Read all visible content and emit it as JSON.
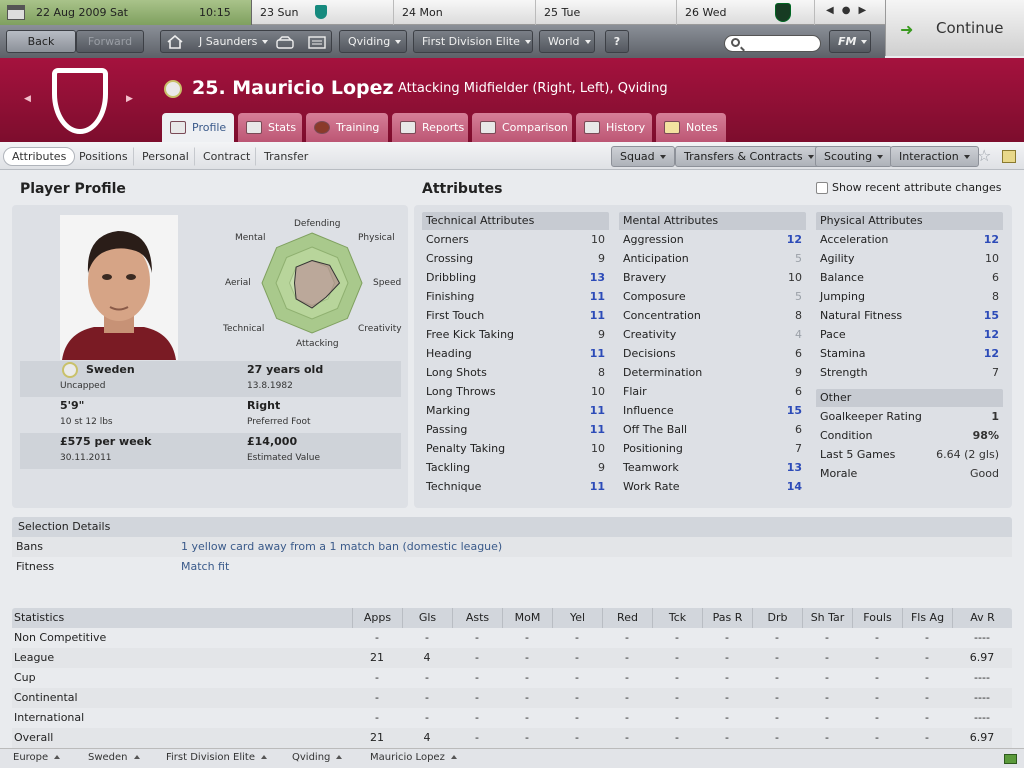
{
  "datebar": {
    "current_date": "22 Aug 2009  Sat",
    "current_time": "10:15",
    "days": [
      {
        "label": "23  Sun"
      },
      {
        "label": "24  Mon"
      },
      {
        "label": "25  Tue"
      },
      {
        "label": "26  Wed"
      }
    ]
  },
  "continue_label": "Continue",
  "toolbar": {
    "back": "Back",
    "forward": "Forward",
    "manager": "J Saunders",
    "club": "Qviding",
    "league": "First Division Elite",
    "world": "World",
    "help": "?",
    "fm": "FM"
  },
  "player": {
    "number_name": "25. Mauricio Lopez",
    "position": "Attacking Midfielder (Right, Left), Qviding"
  },
  "player_tabs": [
    {
      "label": "Profile"
    },
    {
      "label": "Stats"
    },
    {
      "label": "Training"
    },
    {
      "label": "Reports"
    },
    {
      "label": "Comparison"
    },
    {
      "label": "History"
    },
    {
      "label": "Notes"
    }
  ],
  "subtabs": [
    {
      "label": "Attributes"
    },
    {
      "label": "Positions"
    },
    {
      "label": "Personal"
    },
    {
      "label": "Contract"
    },
    {
      "label": "Transfer"
    }
  ],
  "menus": [
    {
      "label": "Squad"
    },
    {
      "label": "Transfers & Contracts"
    },
    {
      "label": "Scouting"
    },
    {
      "label": "Interaction"
    }
  ],
  "profile": {
    "title": "Player Profile",
    "nationality": "Sweden",
    "caps": "Uncapped",
    "age": "27 years old",
    "dob": "13.8.1982",
    "height": "5'9\"",
    "weight": "10 st 12 lbs",
    "foot": "Right",
    "foot_label": "Preferred Foot",
    "wage": "£575 per week",
    "contract_end": "30.11.2011",
    "value": "£14,000",
    "value_label": "Estimated Value",
    "radar_labels": {
      "defending": "Defending",
      "physical": "Physical",
      "speed": "Speed",
      "creativity": "Creativity",
      "attacking": "Attacking",
      "technical": "Technical",
      "aerial": "Aerial",
      "mental": "Mental"
    },
    "radar_values": {
      "Defending": 0.45,
      "Physical": 0.5,
      "Speed": 0.55,
      "Creativity": 0.4,
      "Attacking": 0.5,
      "Technical": 0.45,
      "Aerial": 0.35,
      "Mental": 0.45
    }
  },
  "attributes": {
    "title": "Attributes",
    "recent_label": "Show recent attribute changes",
    "technical": {
      "title": "Technical Attributes",
      "items": [
        {
          "name": "Corners",
          "value": "10",
          "style": ""
        },
        {
          "name": "Crossing",
          "value": "9",
          "style": ""
        },
        {
          "name": "Dribbling",
          "value": "13",
          "style": "hi"
        },
        {
          "name": "Finishing",
          "value": "11",
          "style": "hi"
        },
        {
          "name": "First Touch",
          "value": "11",
          "style": "hi"
        },
        {
          "name": "Free Kick Taking",
          "value": "9",
          "style": ""
        },
        {
          "name": "Heading",
          "value": "11",
          "style": "hi"
        },
        {
          "name": "Long Shots",
          "value": "8",
          "style": ""
        },
        {
          "name": "Long Throws",
          "value": "10",
          "style": ""
        },
        {
          "name": "Marking",
          "value": "11",
          "style": "hi"
        },
        {
          "name": "Passing",
          "value": "11",
          "style": "hi"
        },
        {
          "name": "Penalty Taking",
          "value": "10",
          "style": ""
        },
        {
          "name": "Tackling",
          "value": "9",
          "style": ""
        },
        {
          "name": "Technique",
          "value": "11",
          "style": "hi"
        }
      ]
    },
    "mental": {
      "title": "Mental Attributes",
      "items": [
        {
          "name": "Aggression",
          "value": "12",
          "style": "hi"
        },
        {
          "name": "Anticipation",
          "value": "5",
          "style": "lo"
        },
        {
          "name": "Bravery",
          "value": "10",
          "style": ""
        },
        {
          "name": "Composure",
          "value": "5",
          "style": "lo"
        },
        {
          "name": "Concentration",
          "value": "8",
          "style": ""
        },
        {
          "name": "Creativity",
          "value": "4",
          "style": "lo"
        },
        {
          "name": "Decisions",
          "value": "6",
          "style": ""
        },
        {
          "name": "Determination",
          "value": "9",
          "style": ""
        },
        {
          "name": "Flair",
          "value": "6",
          "style": ""
        },
        {
          "name": "Influence",
          "value": "15",
          "style": "hi"
        },
        {
          "name": "Off The Ball",
          "value": "6",
          "style": ""
        },
        {
          "name": "Positioning",
          "value": "7",
          "style": ""
        },
        {
          "name": "Teamwork",
          "value": "13",
          "style": "hi"
        },
        {
          "name": "Work Rate",
          "value": "14",
          "style": "hi"
        }
      ]
    },
    "physical": {
      "title": "Physical Attributes",
      "items": [
        {
          "name": "Acceleration",
          "value": "12",
          "style": "hi"
        },
        {
          "name": "Agility",
          "value": "10",
          "style": ""
        },
        {
          "name": "Balance",
          "value": "6",
          "style": ""
        },
        {
          "name": "Jumping",
          "value": "8",
          "style": ""
        },
        {
          "name": "Natural Fitness",
          "value": "15",
          "style": "hi"
        },
        {
          "name": "Pace",
          "value": "12",
          "style": "hi"
        },
        {
          "name": "Stamina",
          "value": "12",
          "style": "hi"
        },
        {
          "name": "Strength",
          "value": "7",
          "style": ""
        }
      ]
    },
    "other": {
      "title": "Other",
      "items": [
        {
          "name": "Goalkeeper Rating",
          "value": "1",
          "style": "b"
        },
        {
          "name": "Condition",
          "value": "98%",
          "style": "b"
        },
        {
          "name": "Last 5 Games",
          "value": "6.64 (2 gls)",
          "style": ""
        },
        {
          "name": "Morale",
          "value": "Good",
          "style": ""
        }
      ]
    }
  },
  "selection": {
    "title": "Selection Details",
    "rows": [
      {
        "key": "Bans",
        "value": "1 yellow card away from a 1 match ban (domestic league)"
      },
      {
        "key": "Fitness",
        "value": "Match fit"
      }
    ]
  },
  "statistics": {
    "title": "Statistics",
    "columns": [
      "Apps",
      "Gls",
      "Asts",
      "MoM",
      "Yel",
      "Red",
      "Tck",
      "Pas R",
      "Drb",
      "Sh Tar",
      "Fouls",
      "Fls Ag",
      "Av R"
    ],
    "rows": [
      {
        "name": "Non Competitive",
        "values": [
          "-",
          "-",
          "-",
          "-",
          "-",
          "-",
          "-",
          "-",
          "-",
          "-",
          "-",
          "-",
          "----"
        ]
      },
      {
        "name": "League",
        "values": [
          "21",
          "4",
          "-",
          "-",
          "-",
          "-",
          "-",
          "-",
          "-",
          "-",
          "-",
          "-",
          "6.97"
        ]
      },
      {
        "name": "Cup",
        "values": [
          "-",
          "-",
          "-",
          "-",
          "-",
          "-",
          "-",
          "-",
          "-",
          "-",
          "-",
          "-",
          "----"
        ]
      },
      {
        "name": "Continental",
        "values": [
          "-",
          "-",
          "-",
          "-",
          "-",
          "-",
          "-",
          "-",
          "-",
          "-",
          "-",
          "-",
          "----"
        ]
      },
      {
        "name": "International",
        "values": [
          "-",
          "-",
          "-",
          "-",
          "-",
          "-",
          "-",
          "-",
          "-",
          "-",
          "-",
          "-",
          "----"
        ]
      },
      {
        "name": "Overall",
        "values": [
          "21",
          "4",
          "-",
          "-",
          "-",
          "-",
          "-",
          "-",
          "-",
          "-",
          "-",
          "-",
          "6.97"
        ]
      }
    ]
  },
  "breadcrumbs": [
    {
      "label": "Europe"
    },
    {
      "label": "Sweden"
    },
    {
      "label": "First Division Elite"
    },
    {
      "label": "Qviding"
    },
    {
      "label": "Mauricio Lopez"
    }
  ],
  "colors": {
    "header": "#a5123e",
    "high_attribute": "#2c4bb8",
    "low_attribute": "#9aa0a8"
  }
}
